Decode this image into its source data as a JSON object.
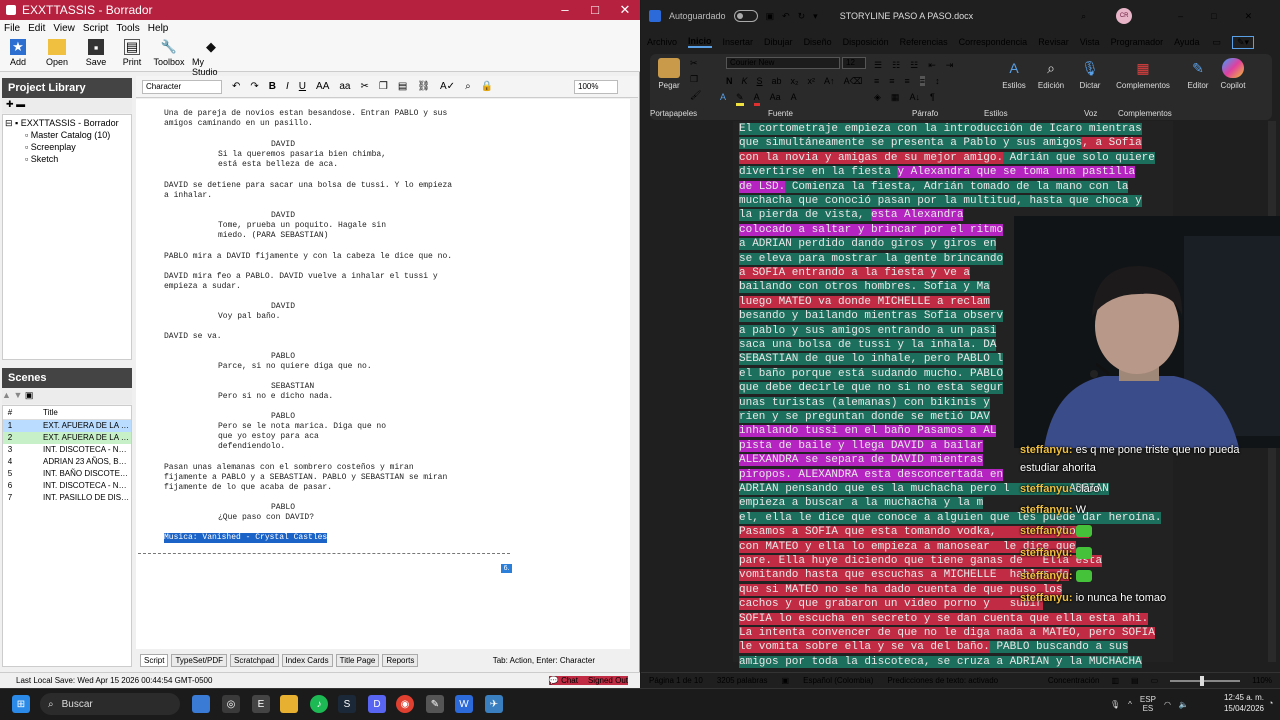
{
  "celtx": {
    "title": "EXXTTASSIS - Borrador",
    "menu": [
      "File",
      "Edit",
      "View",
      "Script",
      "Tools",
      "Help"
    ],
    "toolbar": [
      "Add",
      "Open",
      "Save",
      "Print",
      "Toolbox",
      "My Studio"
    ],
    "project_library": {
      "header": "Project Library",
      "tree": [
        "EXXTTASSIS - Borrador",
        "Master Catalog (10)",
        "Screenplay",
        "Sketch"
      ]
    },
    "scenes": {
      "header": "Scenes",
      "col_num": "#",
      "col_title": "Title",
      "rows": [
        {
          "n": "1",
          "t": "EXT. AFUERA DE LA FIE..."
        },
        {
          "n": "2",
          "t": "EXT. AFUERA DE LA FIE..."
        },
        {
          "n": "3",
          "t": "INT. DISCOTECA - NO..."
        },
        {
          "n": "4",
          "t": "ADRIAN 23 AÑOS, BLA..."
        },
        {
          "n": "5",
          "t": "INT. BAÑO DISCOTEC..."
        },
        {
          "n": "6",
          "t": "INT. DISCOTECA - NO..."
        },
        {
          "n": "7",
          "t": "INT. PASILLO DE DISC..."
        }
      ]
    },
    "format_bar": {
      "element": "Character",
      "zoom": "100%"
    },
    "script_lines": [
      "Una de pareja de novios estan besandose. Entran PABLO y sus",
      "amigos caminando en un pasillo.",
      "DAVID",
      "Si la queremos pasaria bien chimba,",
      "está esta belleza de aca.",
      "DAVID se detiene para sacar una bolsa de tussi. Y lo empieza",
      "a inhalar.",
      "DAVID",
      "Tome, prueba un poquito. Hagale sin",
      "miedo. (PARA SEBASTIAN)",
      "PABLO mira a DAVID fijamente y con la cabeza le dice que no.",
      "DAVID mira feo a PABLO. DAVID vuelve a inhalar el tussi y",
      "empieza a sudar.",
      "DAVID",
      "Voy pal baño.",
      "DAVID se va.",
      "PABLO",
      "Parce, si no quiere diga que no.",
      "SEBASTIAN",
      "Pero si no e dicho nada.",
      "PABLO",
      "Pero se le nota marica. Diga que no",
      "que yo estoy para aca",
      "defendiendolo.",
      "Pasan unas alemanas con el sombrero costeños y miran",
      "fijamente a PABLO y a SEBASTIAN. PABLO y SEBASTIAN se miran",
      "fijamente de lo que acaba de pasar.",
      "PABLO",
      "¿Que paso con DAVID?",
      "Musica: Vanished - Crystal Castles"
    ],
    "page_number": "6.",
    "tabs": [
      "Script",
      "TypeSet/PDF",
      "Scratchpad",
      "Index Cards",
      "Title Page",
      "Reports"
    ],
    "tab_hint": "Tab: Action, Enter: Character",
    "status_left": "Last Local Save: Wed Apr 15 2026 00:44:54 GMT-0500",
    "status_chat": "Chat",
    "status_signed": "Signed Out"
  },
  "word": {
    "autosave": "Autoguardado",
    "doc_title": "STORYLINE PASO A PASO.docx",
    "avatar": "CR",
    "tabs": [
      "Archivo",
      "Inicio",
      "Insertar",
      "Dibujar",
      "Diseño",
      "Disposición",
      "Referencias",
      "Correspondencia",
      "Revisar",
      "Vista",
      "Programador",
      "Ayuda"
    ],
    "active_tab": "Inicio",
    "font_name": "Courier New",
    "font_size": "12",
    "groups": {
      "clipboard": "Portapapeles",
      "font": "Fuente",
      "paragraph": "Párrafo",
      "styles": "Estilos",
      "voice": "Voz",
      "addins": "Complementos"
    },
    "buttons": {
      "paste": "Pegar",
      "styles": "Estilos",
      "edit": "Edición",
      "dictate": "Dictar",
      "addins": "Complementos",
      "editor": "Editor",
      "copilot": "Copilot"
    },
    "doc_lines": [
      {
        "segs": [
          [
            "g",
            "El cortometraje empieza con la introducción de Icaro mientras"
          ]
        ]
      },
      {
        "segs": [
          [
            "g",
            "que simultáneamente se presenta a Pablo y sus amigos"
          ],
          [
            "r",
            ", a Sofia"
          ]
        ]
      },
      {
        "segs": [
          [
            "r",
            "con la novia y amigas de su mejor amigo."
          ],
          [
            "g",
            " Adrián que solo quiere"
          ]
        ]
      },
      {
        "segs": [
          [
            "g",
            "divertirse en la fiesta "
          ],
          [
            "m",
            "y Alexandra que se toma una pastilla"
          ]
        ]
      },
      {
        "segs": [
          [
            "m",
            "de LSD."
          ],
          [
            "g",
            " Comienza la fiesta, Adrián tomado de la mano con la"
          ]
        ]
      },
      {
        "segs": [
          [
            "g",
            "muchacha que conoció pasan por la multitud, hasta que choca y"
          ]
        ]
      },
      {
        "segs": [
          [
            "g",
            "la pierda de vista, "
          ],
          [
            "m",
            "esta Alexandra"
          ]
        ]
      },
      {
        "segs": [
          [
            "m",
            "colocado a saltar y brincar por el ritmo"
          ]
        ]
      },
      {
        "segs": [
          [
            "g",
            "a ADRIAN perdido dando giros y giros en"
          ]
        ]
      },
      {
        "segs": [
          [
            "g",
            "se eleva para mostrar la gente brincando"
          ]
        ]
      },
      {
        "segs": [
          [
            "r",
            "a SOFIA entrando a la fiesta y ve a"
          ]
        ]
      },
      {
        "segs": [
          [
            "g",
            "bailando con otros hombres. Sofia y Ma"
          ]
        ]
      },
      {
        "segs": [
          [
            "r",
            "luego MATEO va donde MICHELLE a reclam"
          ]
        ]
      },
      {
        "segs": [
          [
            "g",
            "besando y bailando mientras Sofia observ"
          ]
        ]
      },
      {
        "segs": [
          [
            "g",
            "a pablo y sus amigos entrando a un pasi"
          ]
        ]
      },
      {
        "segs": [
          [
            "g",
            "saca una bolsa de tussi y la inhala. DA"
          ]
        ]
      },
      {
        "segs": [
          [
            "g",
            "SEBASTIAN de que lo inhale, pero PABLO l"
          ]
        ]
      },
      {
        "segs": [
          [
            "g",
            "el baño porque está sudando mucho. PABLO"
          ]
        ]
      },
      {
        "segs": [
          [
            "g",
            "que debe decirle que no si no esta segur"
          ]
        ]
      },
      {
        "segs": [
          [
            "g",
            "unas turistas (alemanas) con bikinis y"
          ]
        ]
      },
      {
        "segs": [
          [
            "g",
            "rien y se preguntan donde se metió DAV"
          ]
        ]
      },
      {
        "segs": [
          [
            "m",
            "inhalando tussi en el baño Pasamos a AL"
          ]
        ]
      },
      {
        "segs": [
          [
            "m",
            "pista de baile y llega DAVID a bailar"
          ]
        ]
      },
      {
        "segs": [
          [
            "m",
            "ALEXANDRA se separa de DAVID mientras"
          ]
        ]
      },
      {
        "segs": [
          [
            "m",
            "piropos. ALEXANDRA esta desconcertada en"
          ]
        ]
      },
      {
        "segs": [
          [
            "g",
            "ADRIAN pensando que es la muchacha pero l"
          ],
          [
            "g",
            "         ADRIAN"
          ]
        ]
      },
      {
        "segs": [
          [
            "g",
            "empieza a buscar a la muchacha y la m"
          ]
        ]
      },
      {
        "segs": [
          [
            "g",
            "el, ella le dice que conoce a alguien que les puede dar heroína."
          ]
        ]
      },
      {
        "segs": [
          [
            "r",
            "Pasamos a SOFIA que esta tomando vodka,"
          ],
          [
            "r",
            "         Choca"
          ]
        ]
      },
      {
        "segs": [
          [
            "r",
            "con MATEO y ella lo empieza a manosear"
          ],
          [
            "r",
            "  le dice que"
          ]
        ]
      },
      {
        "segs": [
          [
            "r",
            "pare. Ella huye diciendo que tiene ganas de"
          ],
          [
            "r",
            "   Ella esta"
          ]
        ]
      },
      {
        "segs": [
          [
            "r",
            "vomitando hasta que escuchas a MICHELLE"
          ],
          [
            "r",
            "  hablar de"
          ]
        ]
      },
      {
        "segs": [
          [
            "r",
            "que si MATEO no se ha dado cuenta de que"
          ],
          [
            "r",
            " puso los"
          ]
        ]
      },
      {
        "segs": [
          [
            "r",
            "cachos y que grabaron un video porno y"
          ],
          [
            "r",
            "   subir"
          ]
        ]
      },
      {
        "segs": [
          [
            "r",
            "SOFIA lo escucha en secreto y se dan cuenta que ella esta ahi."
          ]
        ]
      },
      {
        "segs": [
          [
            "r",
            "La intenta convencer de que no le diga nada a MATEO, pero SOFIA"
          ]
        ]
      },
      {
        "segs": [
          [
            "r",
            "le vomita sobre ella y se va del baño."
          ],
          [
            "g",
            " PABLO buscando a sus"
          ]
        ]
      },
      {
        "segs": [
          [
            "g",
            "amigos por toda la discoteca, se cruza a ADRIAN y la MUCHACHA"
          ]
        ]
      }
    ],
    "status": {
      "page": "Página 1 de 10",
      "words": "3205 palabras",
      "lang": "Español (Colombia)",
      "predict": "Predicciones de texto: activado",
      "focus": "Concentración",
      "zoom": "110%"
    }
  },
  "chat": [
    {
      "user": "steffanyu:",
      "msg": "es q me pone triste que no pueda"
    },
    {
      "user": "",
      "msg": "estudiar ahorita"
    },
    {
      "user": "steffanyu:",
      "msg": "claro"
    },
    {
      "user": "steffanyu:",
      "msg": "W"
    },
    {
      "user": "steffanyu:",
      "msg": ""
    },
    {
      "user": "steffanyu:",
      "msg": ""
    },
    {
      "user": "steffanyu:",
      "msg": ""
    },
    {
      "user": "steffanyu:",
      "msg": "io nunca he tomao"
    }
  ],
  "taskbar": {
    "search": "Buscar",
    "lang": "ESP",
    "region": "ES",
    "time": "12:45 a. m.",
    "date": "15/04/2026"
  },
  "colors": {
    "celtx_title": "#b5213f",
    "green_hl": "#1c6f5c",
    "red_hl": "#c12c44",
    "magenta_hl": "#b524c0",
    "chat_user": "#f0c040"
  }
}
